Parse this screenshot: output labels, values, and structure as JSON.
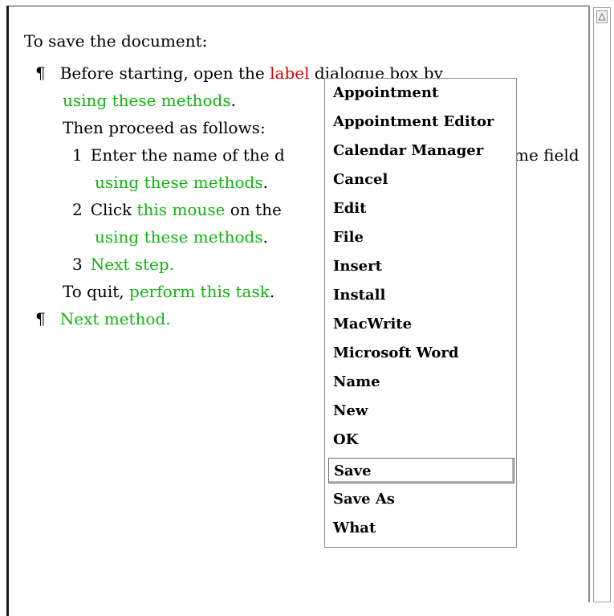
{
  "document": {
    "heading": "To save the document:",
    "para1": {
      "pilcrow": "¶",
      "text_before": "Before starting, open the ",
      "label_word": "label",
      "text_after": " dialogue box by",
      "methods": "using these methods",
      "period": "."
    },
    "then": "Then proceed as follows:",
    "steps": [
      {
        "number": "1",
        "text": "Enter the name of the d",
        "tail": "me field",
        "methods": "using these methods",
        "period": "."
      },
      {
        "number": "2",
        "text_before": "Click ",
        "green": "this mouse",
        "text_after": " on the",
        "methods": "using these methods",
        "period": "."
      },
      {
        "number": "3",
        "green": "Next step."
      }
    ],
    "quit": {
      "before": "To quit, ",
      "green": "perform this task",
      "after": "."
    },
    "para2": {
      "pilcrow": "¶",
      "text": "Next method."
    }
  },
  "menu": {
    "items": [
      "Appointment",
      "Appointment Editor",
      "Calendar Manager",
      "Cancel",
      "Edit",
      "File",
      "Insert",
      "Install",
      "MacWrite",
      "Microsoft Word",
      "Name",
      "New",
      "OK",
      "Save",
      "Save As",
      "What"
    ],
    "selected": "Save"
  },
  "colors": {
    "link_green": "#12b312",
    "label_red": "#e00000"
  }
}
